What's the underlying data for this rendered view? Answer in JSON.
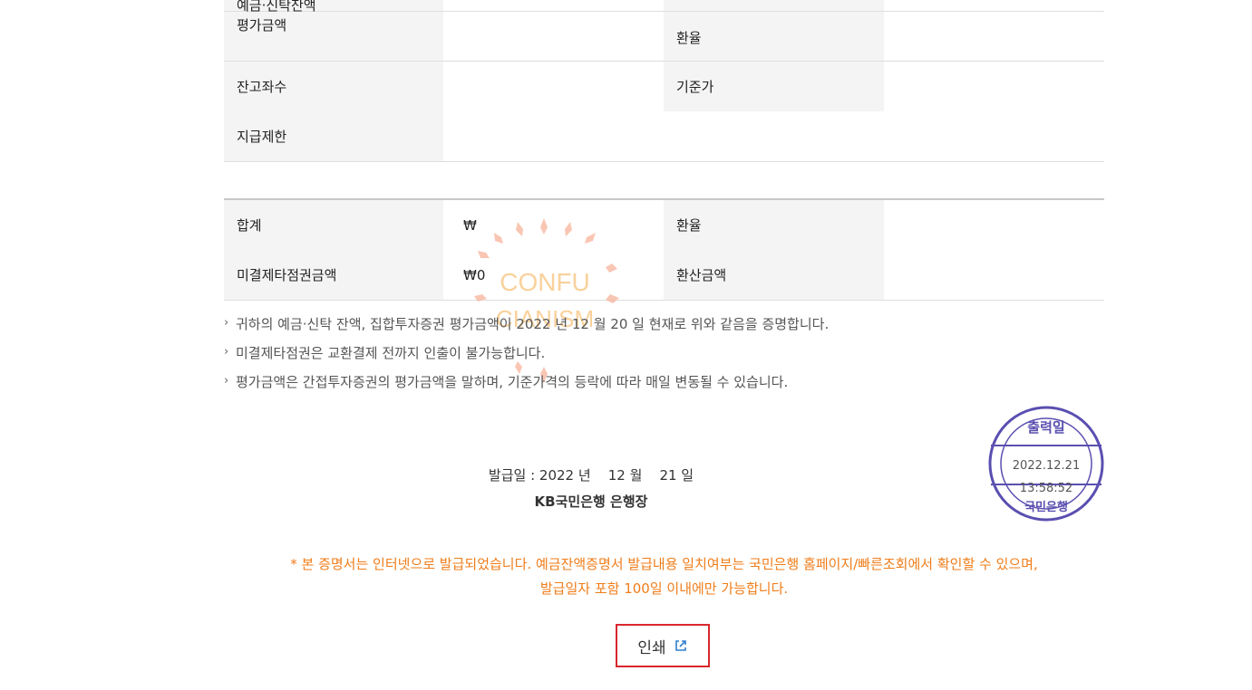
{
  "table_top": {
    "row1": {
      "label_partial": "예금·신탁잔액",
      "label": "평가금액",
      "col3": "환율"
    },
    "row2": {
      "label": "잔고좌수",
      "col3": "기준가"
    },
    "row3": {
      "label": "지급제한"
    }
  },
  "table_total": {
    "row1": {
      "label": "합계",
      "value": "₩",
      "col3": "환율"
    },
    "row2": {
      "label": "미결제타점권금액",
      "value": "₩0",
      "col3": "환산금액"
    }
  },
  "notes": [
    "귀하의 예금·신탁 잔액, 집합투자증권 평가금액이 2022 년  12 월  20 일 현재로 위와 같음을 증명합니다.",
    "미결제타점권은 교환결제 전까지 인출이 불가능합니다.",
    "평가금액은 간접투자증권의 평가금액을 말하며, 기준가격의 등락에 따라 매일 변동될 수 있습니다."
  ],
  "issue_date": "발급일 : 2022 년    12 월    21 일",
  "bank_name": "KB국민은행 은행장",
  "stamp": {
    "top": "출력일",
    "date": "2022.12.21",
    "time": "13:58:52",
    "bottom": "국민은행",
    "color": "#5a4fb0"
  },
  "watermark": {
    "line1": "CONFU",
    "line2": "CIANISM",
    "color": "#f6a07a"
  },
  "orange_notice": [
    "* 본 증명서는 인터넷으로 발급되었습니다. 예금잔액증명서 발급내용 일치여부는 국민은행 홈페이지/빠른조회에서 확인할 수 있으며,",
    "발급일자 포함 100일 이내에만 가능합니다."
  ],
  "print_button": {
    "label": "인쇄",
    "icon": "external-link-icon",
    "border_color": "#d9272e"
  }
}
